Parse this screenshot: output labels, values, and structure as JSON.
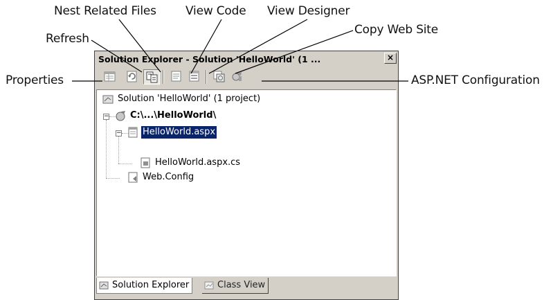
{
  "callouts": {
    "nest_related_files": "Nest Related Files",
    "view_code": "View Code",
    "view_designer": "View Designer",
    "copy_web_site": "Copy Web Site",
    "refresh": "Refresh",
    "properties": "Properties",
    "asp_net_configuration": "ASP.NET Configuration"
  },
  "window": {
    "title": "Solution Explorer - Solution 'HelloWorld' (1 ...",
    "close_glyph": "×"
  },
  "toolbar": {
    "icons": [
      "properties-icon",
      "refresh-icon",
      "nest-related-files-icon",
      "view-code-icon",
      "view-designer-icon",
      "copy-web-site-icon",
      "asp-net-configuration-icon"
    ],
    "active": "nest-related-files-icon"
  },
  "tree": {
    "solution": "Solution 'HelloWorld' (1 project)",
    "project": "C:\\...\\HelloWorld\\",
    "page": "HelloWorld.aspx",
    "code_behind": "HelloWorld.aspx.cs",
    "config": "Web.Config"
  },
  "tabs": {
    "solution_explorer": "Solution Explorer",
    "class_view": "Class View"
  }
}
